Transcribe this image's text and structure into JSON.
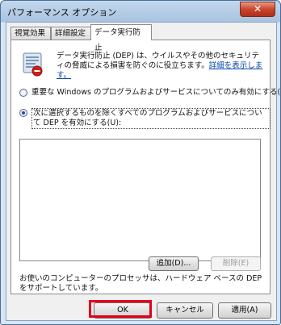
{
  "window": {
    "title": "パフォーマンス オプション",
    "close_label": "✕"
  },
  "tabs": [
    {
      "label": "視覚効果",
      "active": false
    },
    {
      "label": "詳細設定",
      "active": false
    },
    {
      "label": "データ実行防止",
      "active": true
    }
  ],
  "dep": {
    "description": "データ実行防止 (DEP) は、ウイルスやその他のセキュリティの脅威による損害を防ぐのに役立ちます。",
    "link_text": "詳細を表示します。",
    "option1_label": "重要な Windows のプログラムおよびサービスについてのみ有効にする(T)",
    "option2_label": "次に選択するものを除くすべてのプログラムおよびサービスについて DEP を有効にする(U):",
    "selected_option": 2,
    "exceptions_list": [],
    "add_button": "追加(D)...",
    "remove_button": "削除(E)",
    "note": "お使いのコンピューターのプロセッサは、ハードウェア ベースの DEP をサポートしています。"
  },
  "footer": {
    "ok": "OK",
    "cancel": "キャンセル",
    "apply": "適用(A)"
  },
  "colors": {
    "highlight_border": "#e3001b",
    "link": "#0645ad"
  },
  "icons": {
    "dep": "dep-shield-icon"
  }
}
